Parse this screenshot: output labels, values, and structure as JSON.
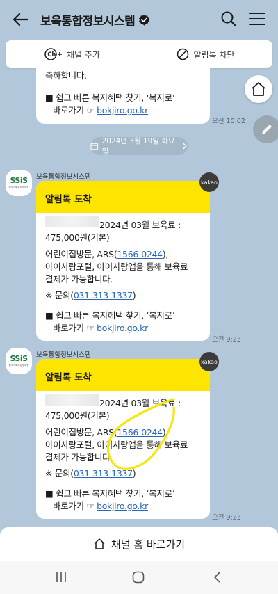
{
  "header": {
    "title": "보육통합정보시스템"
  },
  "actionbar": {
    "add_channel": "채널 추가",
    "block_alimtalk": "알림톡 차단",
    "channel_badge": "Ch"
  },
  "prev_message": {
    "line1": "축하합니다.",
    "line2": "■ 쉽고 빠른 복지혜택 찾기, ‘복지로’",
    "line3_prefix": "바로가기 ☞ ",
    "line3_link": "bokjiro.go.kr",
    "time": "오전 10:02"
  },
  "date_divider": "2024년 3월 19일 화요일",
  "messages": [
    {
      "sender": "보육통합정보시스템",
      "avatar_logo": "SSiS",
      "avatar_sub": "한국사회보장정보원",
      "badge": "kakao",
      "header": "알림톡 도착",
      "line1": "2024년 03월 보육료 :",
      "line2": "475,000원(기본)",
      "line3_prefix": "어린이집방문, ARS(",
      "line3_link": "1566-0244",
      "line3_suffix": "),",
      "line4": "아이사랑포털, 아이사랑앱을 통해 보육료",
      "line5": "결제가 가능합니다.",
      "line6_prefix": "※ 문의(",
      "line6_link": "031-313-1337",
      "line6_suffix": ")",
      "line7": "■ 쉽고 빠른 복지혜택 찾기, ‘복지로’",
      "line8_prefix": "바로가기 ☞ ",
      "line8_link": "bokjiro.go.kr",
      "time": "오전 9:23"
    },
    {
      "sender": "보육통합정보시스템",
      "avatar_logo": "SSiS",
      "avatar_sub": "한국사회보장정보원",
      "badge": "kakao",
      "header": "알림톡 도착",
      "line1": "2024년 03월 보육료 :",
      "line2": "475,000원(기본)",
      "line3_prefix": "어린이집방문, ARS(",
      "line3_link": "1566-0244",
      "line3_suffix": "),",
      "line4": "아이사랑포털, 아이사랑앱을 통해 보육료",
      "line5": "결제가 가능합니다.",
      "line6_prefix": "※ 문의(",
      "line6_link": "031-313-1337",
      "line6_suffix": ")",
      "line7": "■ 쉽고 빠른 복지혜택 찾기, ‘복지로’",
      "line8_prefix": "바로가기 ☞ ",
      "line8_link": "bokjiro.go.kr",
      "time": "오전 9:23"
    }
  ],
  "bottom_button": "채널 홈 바로가기",
  "colors": {
    "background": "#b2c7d9",
    "alimtalk_yellow": "#fee500",
    "link": "#2866b8",
    "highlight_marker": "#f2e600"
  },
  "icons": [
    "back-arrow-icon",
    "verified-badge-icon",
    "search-icon",
    "menu-icon",
    "channel-add-icon",
    "block-icon",
    "home-icon",
    "pencil-icon",
    "calendar-icon",
    "chevron-right-icon",
    "recents-icon",
    "home-nav-icon",
    "back-nav-icon"
  ]
}
